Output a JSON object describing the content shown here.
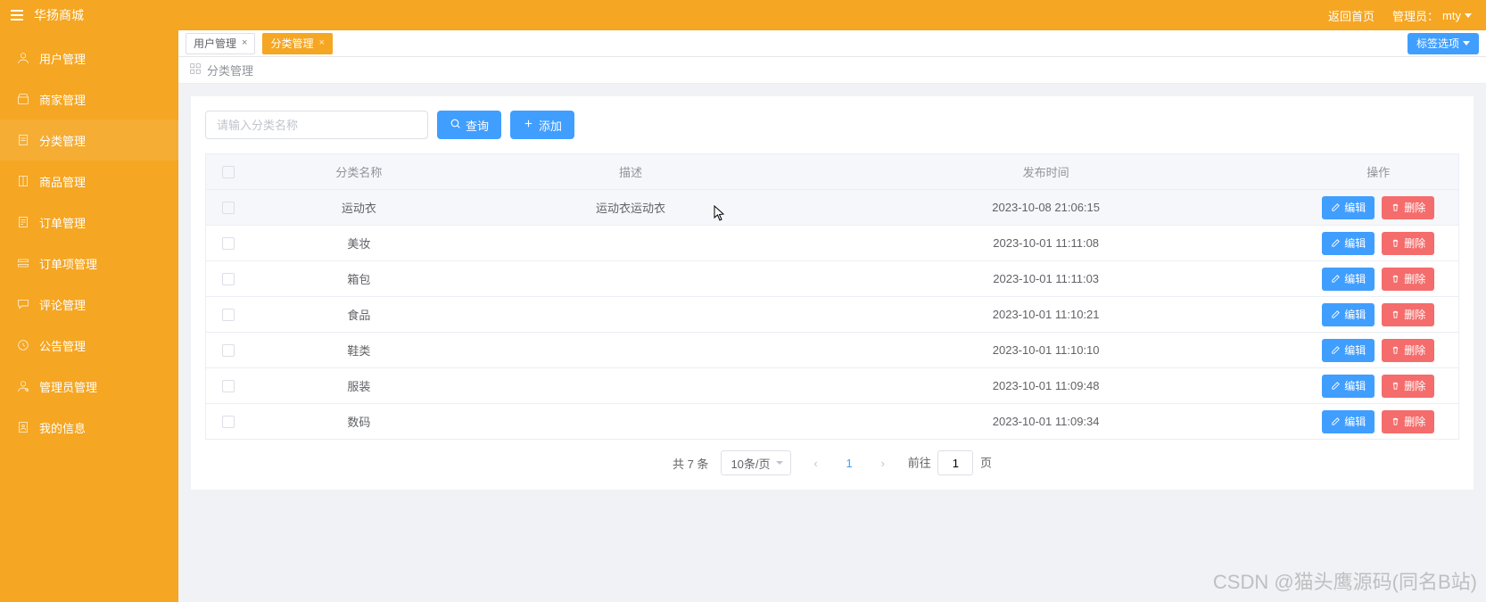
{
  "brand": "华扬商城",
  "sidebar": {
    "items": [
      {
        "label": "用户管理",
        "icon": "user"
      },
      {
        "label": "商家管理",
        "icon": "shop"
      },
      {
        "label": "分类管理",
        "icon": "list"
      },
      {
        "label": "商品管理",
        "icon": "book"
      },
      {
        "label": "订单管理",
        "icon": "order"
      },
      {
        "label": "订单项管理",
        "icon": "items"
      },
      {
        "label": "评论管理",
        "icon": "comment"
      },
      {
        "label": "公告管理",
        "icon": "bell"
      },
      {
        "label": "管理员管理",
        "icon": "admin"
      },
      {
        "label": "我的信息",
        "icon": "profile"
      }
    ]
  },
  "topbar": {
    "home": "返回首页",
    "admin_prefix": "管理员：",
    "admin_name": "mty"
  },
  "tabs": [
    {
      "label": "用户管理",
      "active": false
    },
    {
      "label": "分类管理",
      "active": true
    }
  ],
  "tab_opts_label": "标签选项",
  "breadcrumb": "分类管理",
  "search": {
    "placeholder": "请输入分类名称",
    "query_btn": "查询",
    "add_btn": "添加"
  },
  "table": {
    "headers": {
      "name": "分类名称",
      "desc": "描述",
      "time": "发布时间",
      "ops": "操作"
    },
    "edit_label": "编辑",
    "del_label": "删除",
    "rows": [
      {
        "name": "运动衣",
        "desc": "运动衣运动衣",
        "time": "2023-10-08 21:06:15"
      },
      {
        "name": "美妆",
        "desc": "",
        "time": "2023-10-01 11:11:08"
      },
      {
        "name": "箱包",
        "desc": "",
        "time": "2023-10-01 11:11:03"
      },
      {
        "name": "食品",
        "desc": "",
        "time": "2023-10-01 11:10:21"
      },
      {
        "name": "鞋类",
        "desc": "",
        "time": "2023-10-01 11:10:10"
      },
      {
        "name": "服装",
        "desc": "",
        "time": "2023-10-01 11:09:48"
      },
      {
        "name": "数码",
        "desc": "",
        "time": "2023-10-01 11:09:34"
      }
    ]
  },
  "pagination": {
    "total_text": "共 7 条",
    "page_size_label": "10条/页",
    "current": "1",
    "goto_prefix": "前往",
    "goto_value": "1",
    "goto_suffix": "页"
  },
  "watermark": "CSDN @猫头鹰源码(同名B站)"
}
